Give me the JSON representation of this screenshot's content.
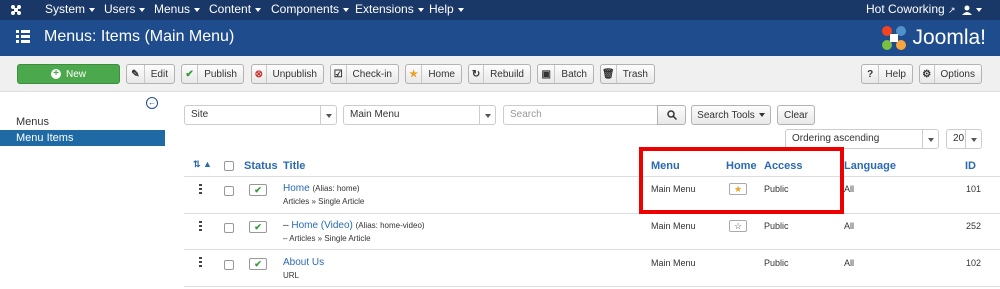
{
  "topnav": {
    "items": [
      "System",
      "Users",
      "Menus",
      "Content",
      "Components",
      "Extensions",
      "Help"
    ],
    "site_link": "Hot Coworking"
  },
  "header": {
    "title": "Menus: Items (Main Menu)",
    "brand": "Joomla!"
  },
  "toolbar": {
    "new": "New",
    "edit": "Edit",
    "publish": "Publish",
    "unpublish": "Unpublish",
    "checkin": "Check-in",
    "home": "Home",
    "rebuild": "Rebuild",
    "batch": "Batch",
    "trash": "Trash",
    "help": "Help",
    "options": "Options"
  },
  "sidebar": {
    "items": [
      "Menus",
      "Menu Items"
    ]
  },
  "filters": {
    "client": "Site",
    "menu": "Main Menu",
    "search_placeholder": "Search",
    "search_tools": "Search Tools",
    "clear": "Clear",
    "ordering": "Ordering ascending",
    "limit": "20"
  },
  "table": {
    "headers": {
      "status": "Status",
      "title": "Title",
      "menu": "Menu",
      "home": "Home",
      "access": "Access",
      "language": "Language",
      "id": "ID"
    },
    "rows": [
      {
        "title": "Home",
        "prefix": "",
        "alias": "(Alias: home)",
        "type": "Articles » Single Article",
        "menu": "Main Menu",
        "access": "Public",
        "language": "All",
        "id": "101",
        "is_home": true
      },
      {
        "title": "Home (Video)",
        "prefix": "–",
        "alias": "(Alias: home-video)",
        "type": "– Articles » Single Article",
        "menu": "Main Menu",
        "access": "Public",
        "language": "All",
        "id": "252",
        "is_home": false
      },
      {
        "title": "About Us",
        "prefix": "",
        "alias": "",
        "type": "URL",
        "menu": "Main Menu",
        "access": "Public",
        "language": "All",
        "id": "102",
        "is_home": false
      }
    ]
  },
  "colors": {
    "nav": "#1a3867",
    "header": "#1f4c8c",
    "new_button": "#4ca84c",
    "highlight": "#e00000",
    "link": "#2a6ab1"
  }
}
